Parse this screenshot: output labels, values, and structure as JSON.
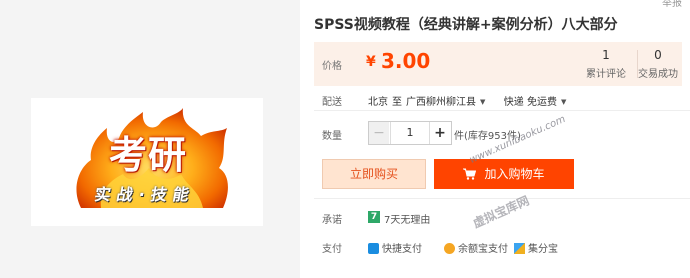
{
  "corner_text": "举报",
  "gallery": {
    "image_title": "考研",
    "image_subtitle": "实战·技能"
  },
  "product": {
    "title": "SPSS视频教程（经典讲解+案例分析）八大部分"
  },
  "price": {
    "label": "价格",
    "currency": "¥",
    "value": "3.00",
    "reviews_count": "1",
    "reviews_label": "累计评论",
    "sales_count": "0",
    "sales_label": "交易成功"
  },
  "shipping": {
    "label": "配送",
    "from": "北京",
    "to_word": "至",
    "destination": "广西柳州柳江县",
    "method": "快递 免运费"
  },
  "quantity": {
    "label": "数量",
    "minus": "−",
    "value": "1",
    "plus": "+",
    "stock": "件(库存953件)"
  },
  "actions": {
    "buy_now": "立即购买",
    "add_to_cart": "加入购物车"
  },
  "promise": {
    "label": "承诺",
    "icon_text": "7",
    "text": "7天无理由"
  },
  "payment": {
    "label": "支付",
    "methods": [
      "快捷支付",
      "余额宝支付",
      "集分宝"
    ]
  },
  "watermark": {
    "url": "www.xunibaoku.com",
    "site": "虚拟宝库网"
  },
  "colors": {
    "accent": "#ff4400",
    "price": "#ff4400",
    "price_panel_bg": "#fcf0e8",
    "buy_bg": "#ffe4d0",
    "promise_green": "#2ea868"
  },
  "icons": {
    "cart": "shopping-cart-icon",
    "dropdown": "triangle-down-icon",
    "promise": "seven-day-icon",
    "quick_pay": "quick-pay-icon",
    "yuebao": "yuebao-icon",
    "jifenbao": "jifenbao-icon"
  }
}
